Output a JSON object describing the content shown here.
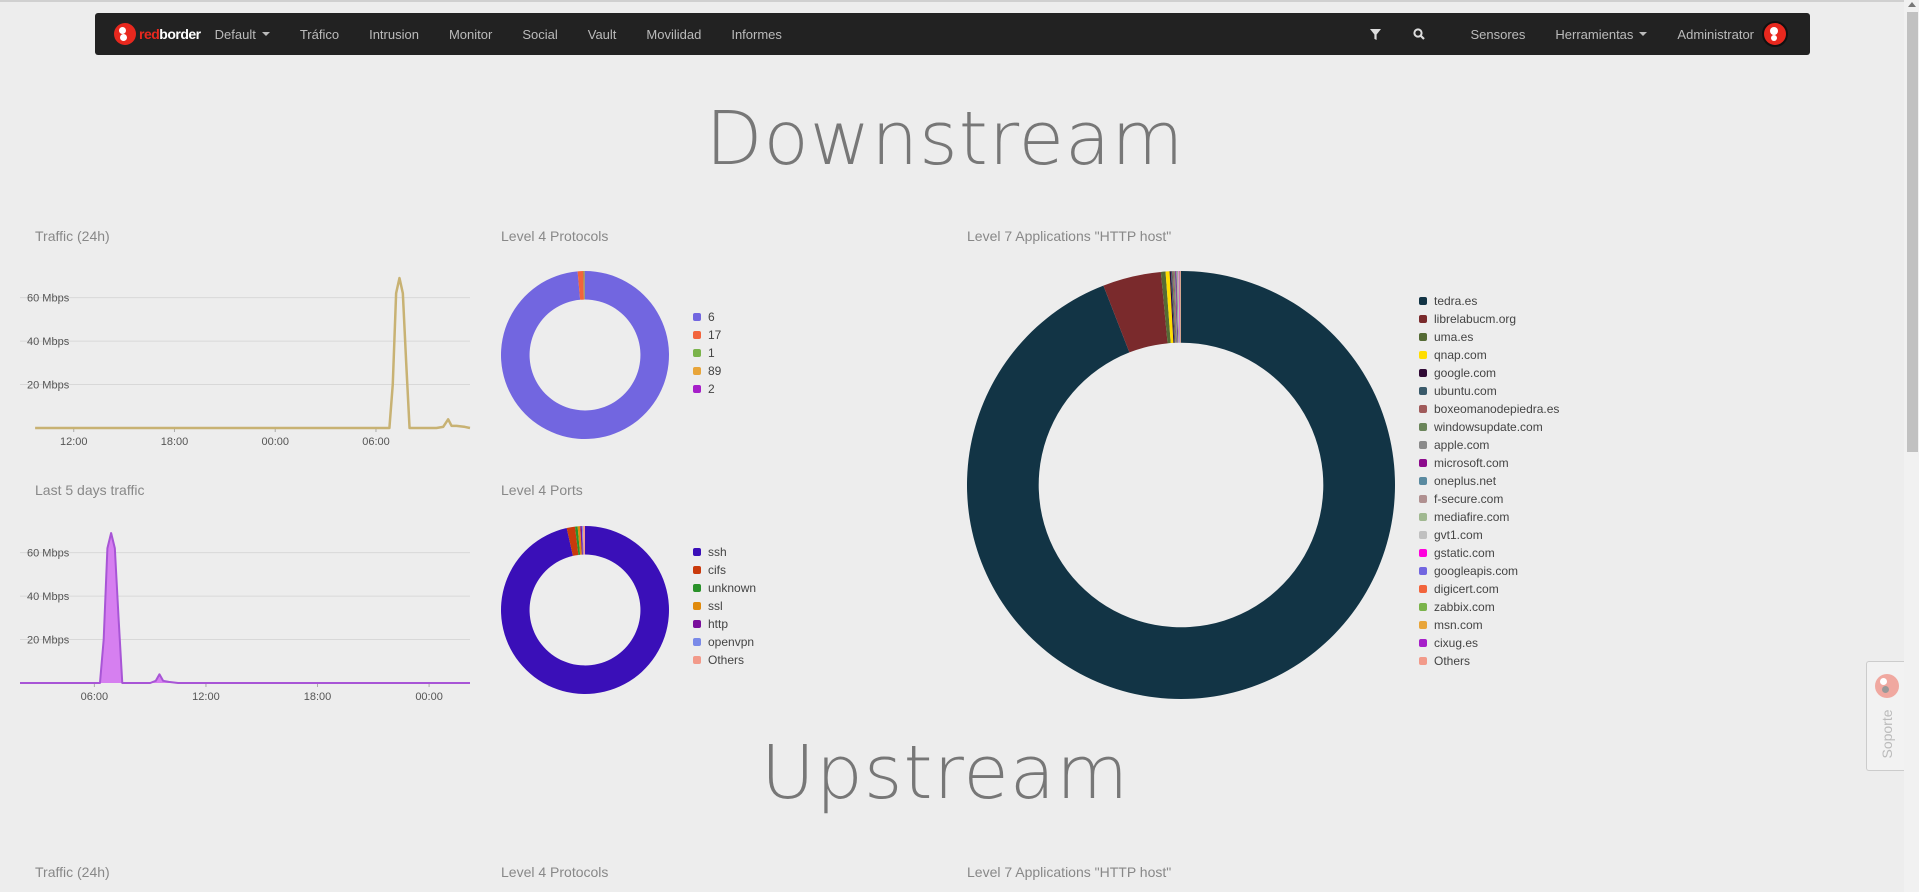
{
  "navbar": {
    "brand": {
      "red": "red",
      "white": "border"
    },
    "dashboard_select": "Default",
    "items": [
      "Tráfico",
      "Intrusion",
      "Monitor",
      "Social",
      "Vault",
      "Movilidad",
      "Informes"
    ],
    "filter_icon": "filter-icon",
    "search_icon": "search-icon",
    "sensores": "Sensores",
    "herramientas": "Herramientas",
    "user": "Administrator"
  },
  "sections": {
    "downstream": "Downstream",
    "upstream": "Upstream"
  },
  "panels": {
    "traffic24": "Traffic (24h)",
    "last5days": "Last 5 days traffic",
    "l4protocols": "Level 4 Protocols",
    "l4ports": "Level 4 Ports",
    "l7apps": "Level 7 Applications \"HTTP host\""
  },
  "upstream_panels": {
    "traffic24": "Traffic (24h)",
    "l4protocols": "Level 4 Protocols",
    "l7apps": "Level 7 Applications \"HTTP host\""
  },
  "soporte": "Soporte",
  "chart_data": [
    {
      "id": "traffic24",
      "type": "line",
      "title": "Traffic (24h)",
      "color": "#c8b273",
      "ylabel": "",
      "ylim": [
        0,
        75
      ],
      "yticks": [
        20,
        40,
        60
      ],
      "ytick_labels": [
        "20 Mbps",
        "40 Mbps",
        "60 Mbps"
      ],
      "xlim": [
        -2.3,
        10.3
      ],
      "xticks": [
        0,
        6,
        12,
        18
      ],
      "xtick_labels": [
        "12:00",
        "18:00",
        "00:00",
        "06:00"
      ],
      "x": [
        -2.3,
        18.8,
        19.0,
        19.2,
        19.4,
        19.6,
        19.8,
        20.0,
        20.2,
        20.6,
        21.0,
        21.6,
        22.0,
        22.3,
        22.5,
        22.8,
        23.3,
        23.6
      ],
      "y": [
        0,
        0,
        20,
        62,
        69,
        62,
        30,
        0,
        0,
        0,
        0,
        0,
        0.5,
        4,
        1,
        1,
        0.5,
        0
      ],
      "grid": true,
      "note": "x in hours from 12:00; plotted using offset"
    },
    {
      "id": "last5days",
      "type": "area",
      "title": "Last 5 days traffic",
      "color": "#a855d6",
      "fill": "#d67ff0",
      "ylim": [
        0,
        75
      ],
      "yticks": [
        20,
        40,
        60
      ],
      "ytick_labels": [
        "20 Mbps",
        "40 Mbps",
        "60 Mbps"
      ],
      "xticks": [
        6,
        12,
        18,
        24
      ],
      "xtick_labels": [
        "06:00",
        "12:00",
        "18:00",
        "00:00"
      ],
      "x": [
        2.0,
        6.3,
        6.5,
        6.7,
        6.9,
        7.1,
        7.3,
        7.5,
        8.0,
        9.0,
        9.3,
        9.5,
        9.7,
        10.0,
        10.5,
        26.2
      ],
      "y": [
        0,
        0,
        20,
        62,
        69,
        62,
        30,
        0,
        0,
        0,
        1,
        4,
        1,
        0.5,
        0,
        0
      ],
      "grid": true
    },
    {
      "id": "l4protocols",
      "type": "pie",
      "title": "Level 4 Protocols",
      "labels": [
        "6",
        "17",
        "1",
        "89",
        "2"
      ],
      "values": [
        98.6,
        1.1,
        0.2,
        0.05,
        0.05
      ],
      "colors": [
        "#7266e0",
        "#f2643c",
        "#7ab34a",
        "#e8a53a",
        "#a61fc9"
      ]
    },
    {
      "id": "l4ports",
      "type": "pie",
      "title": "Level 4 Ports",
      "labels": [
        "ssh",
        "cifs",
        "unknown",
        "ssl",
        "http",
        "openvpn",
        "Others"
      ],
      "values": [
        96.5,
        1.6,
        0.5,
        0.5,
        0.3,
        0.2,
        0.4
      ],
      "colors": [
        "#3a0fb8",
        "#c93a0c",
        "#2a922a",
        "#e08a0c",
        "#7a0f9c",
        "#7a8ae8",
        "#f29a8a"
      ]
    },
    {
      "id": "l7apps",
      "type": "pie",
      "title": "Level 7 Applications \"HTTP host\"",
      "labels": [
        "tedra.es",
        "librelabucm.org",
        "uma.es",
        "qnap.com",
        "google.com",
        "ubuntu.com",
        "boxeomanodepiedra.es",
        "windowsupdate.com",
        "apple.com",
        "microsoft.com",
        "oneplus.net",
        "f-secure.com",
        "mediafire.com",
        "gvt1.com",
        "gstatic.com",
        "googleapis.com",
        "digicert.com",
        "zabbix.com",
        "msn.com",
        "cixug.es",
        "Others"
      ],
      "values": [
        94.0,
        4.4,
        0.35,
        0.3,
        0.1,
        0.1,
        0.08,
        0.08,
        0.07,
        0.06,
        0.05,
        0.05,
        0.05,
        0.04,
        0.03,
        0.03,
        0.03,
        0.02,
        0.02,
        0.02,
        0.02
      ],
      "colors": [
        "#123445",
        "#7a2a2c",
        "#556b35",
        "#ffdd00",
        "#300a35",
        "#3a5a6a",
        "#a05a5a",
        "#6a855a",
        "#8a8a8a",
        "#8c0a8c",
        "#5a8aa0",
        "#b09090",
        "#a0b890",
        "#c0c0c0",
        "#ff00dd",
        "#7266e0",
        "#f2643c",
        "#7ab34a",
        "#e8a53a",
        "#a61fc9",
        "#f29a8a"
      ]
    }
  ]
}
